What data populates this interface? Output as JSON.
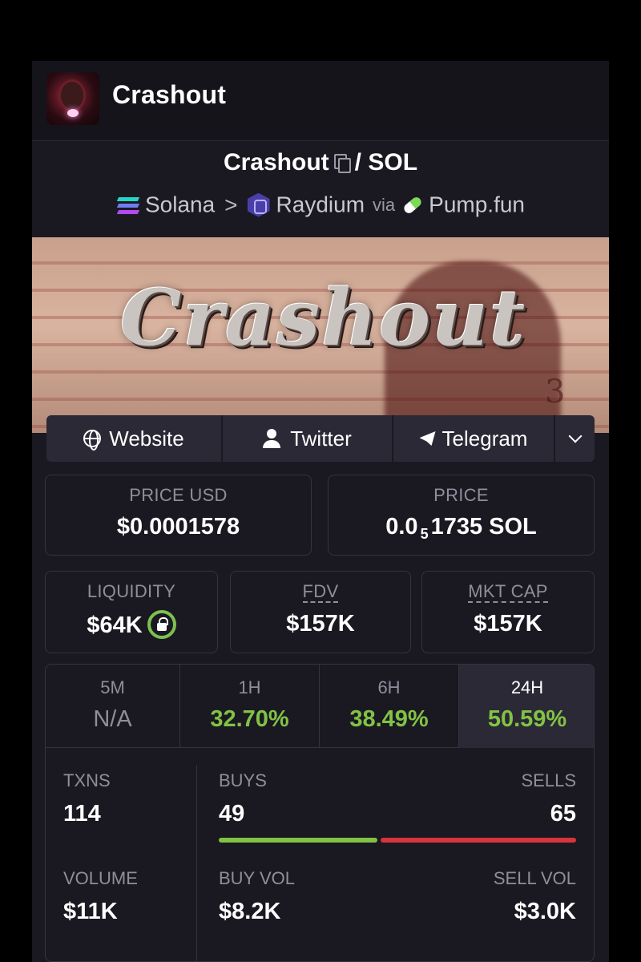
{
  "header": {
    "title": "Crashout"
  },
  "pair": {
    "base": "Crashout",
    "separator": "/",
    "quote": "SOL"
  },
  "chain": {
    "network": "Solana",
    "dex": "Raydium",
    "via": "via",
    "launchpad": "Pump.fun"
  },
  "banner": {
    "logo_text": "Crashout",
    "corner_mark": "3"
  },
  "socials": {
    "website": "Website",
    "twitter": "Twitter",
    "telegram": "Telegram"
  },
  "stats": {
    "price_usd_label": "PRICE USD",
    "price_usd": "$0.0001578",
    "price_label": "PRICE",
    "price_prefix": "0.0",
    "price_zeros": "5",
    "price_suffix": "1735 SOL",
    "liquidity_label": "LIQUIDITY",
    "liquidity": "$64K",
    "fdv_label": "FDV",
    "fdv": "$157K",
    "mktcap_label": "MKT CAP",
    "mktcap": "$157K"
  },
  "timeframes": [
    {
      "label": "5M",
      "value": "N/A"
    },
    {
      "label": "1H",
      "value": "32.70%"
    },
    {
      "label": "6H",
      "value": "38.49%"
    },
    {
      "label": "24H",
      "value": "50.59%"
    }
  ],
  "active_timeframe": "24H",
  "txns": {
    "txns_label": "TXNS",
    "txns": "114",
    "buys_label": "BUYS",
    "buys": "49",
    "sells_label": "SELLS",
    "sells": "65",
    "volume_label": "VOLUME",
    "volume": "$11K",
    "buy_vol_label": "BUY VOL",
    "buy_vol": "$8.2K",
    "sell_vol_label": "SELL VOL",
    "sell_vol": "$3.0K"
  },
  "colors": {
    "positive": "#82c244",
    "negative": "#d9343a",
    "accent_lock": "#7cc14e"
  }
}
